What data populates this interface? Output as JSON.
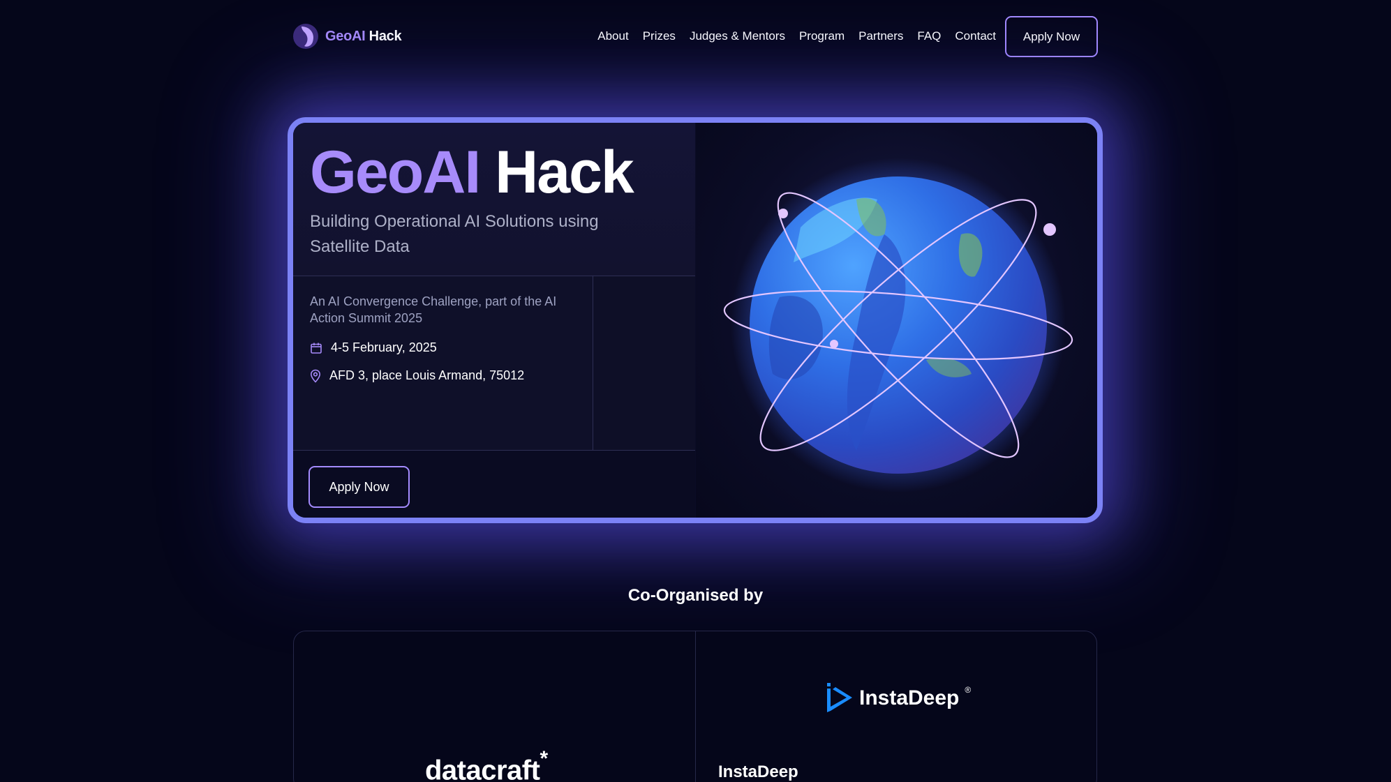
{
  "nav": {
    "logo": {
      "geo": "GeoAI",
      "hack": "Hack"
    },
    "links": [
      "About",
      "Prizes",
      "Judges & Mentors",
      "Program",
      "Partners",
      "FAQ",
      "Contact"
    ],
    "apply_label": "Apply Now"
  },
  "hero": {
    "title_geo": "GeoAI",
    "title_hack": "Hack",
    "subtitle": "Building Operational AI Solutions using Satellite Data",
    "description": "An AI Convergence Challenge, part of the AI Action Summit 2025",
    "date": "4-5 February, 2025",
    "location": "AFD 3, place Louis Armand, 75012",
    "apply_label": "Apply Now"
  },
  "co_organised": {
    "title": "Co-Organised by",
    "org1_logo_text": "datacraft",
    "org1_logo_mark": "*",
    "org2_logo_text": "InstaDeep",
    "org2_logo_reg": "®",
    "org2_label": "InstaDeep"
  },
  "colors": {
    "background": "#05061a",
    "accent_purple": "#a78bfa",
    "hero_border": "#7c82f6",
    "button_border": "#a48bff",
    "instadeep_blue": "#1a8cff"
  },
  "icons": {
    "date": "calendar-icon",
    "location": "map-pin-icon",
    "logo": "geoai-logo-icon",
    "hero_image": "globe-illustration"
  }
}
